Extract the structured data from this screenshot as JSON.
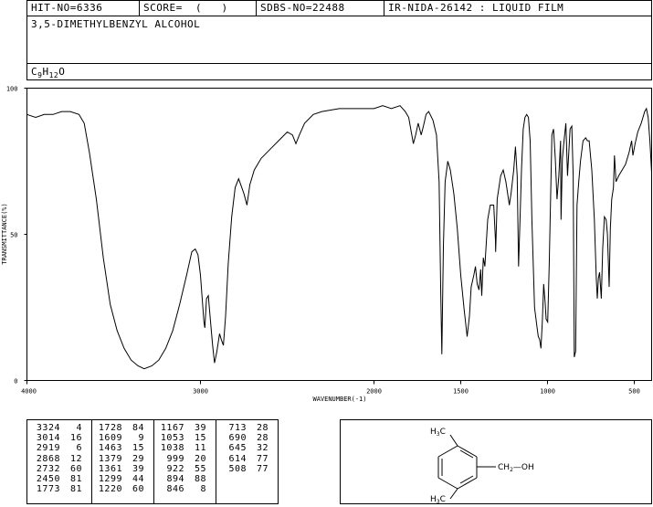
{
  "header": {
    "hit": "HIT-NO=6336",
    "score": "SCORE=  (   )",
    "sdbs": "SDBS-NO=22488",
    "ir": "IR-NIDA-26142 : LIQUID FILM"
  },
  "compound": {
    "name": "3,5-DIMETHYLBENZYL ALCOHOL",
    "formula_parts": [
      "C",
      "9",
      "H",
      "12",
      "O"
    ]
  },
  "chart_data": {
    "type": "line",
    "ylabel": "TRANSMITTANCE(%)",
    "xlabel": "WAVENUMBER(-1)",
    "xlim": [
      4000,
      400
    ],
    "ylim": [
      0,
      100
    ],
    "x_ticks": [
      "4000",
      "3000",
      "2000",
      "1500",
      "1000",
      "500"
    ],
    "y_ticks": [
      "100",
      "50",
      "0"
    ],
    "series": [
      {
        "points": [
          [
            4000,
            91
          ],
          [
            3950,
            90
          ],
          [
            3900,
            91
          ],
          [
            3850,
            91
          ],
          [
            3800,
            92
          ],
          [
            3750,
            92
          ],
          [
            3700,
            91
          ],
          [
            3670,
            88
          ],
          [
            3640,
            78
          ],
          [
            3600,
            62
          ],
          [
            3560,
            42
          ],
          [
            3520,
            26
          ],
          [
            3480,
            17
          ],
          [
            3440,
            11
          ],
          [
            3400,
            7
          ],
          [
            3360,
            5
          ],
          [
            3324,
            4
          ],
          [
            3280,
            5
          ],
          [
            3240,
            7
          ],
          [
            3200,
            11
          ],
          [
            3160,
            17
          ],
          [
            3120,
            26
          ],
          [
            3080,
            36
          ],
          [
            3050,
            44
          ],
          [
            3030,
            45
          ],
          [
            3014,
            43
          ],
          [
            3000,
            36
          ],
          [
            2990,
            28
          ],
          [
            2980,
            20
          ],
          [
            2975,
            18
          ],
          [
            2965,
            28
          ],
          [
            2955,
            29
          ],
          [
            2945,
            22
          ],
          [
            2930,
            12
          ],
          [
            2919,
            6
          ],
          [
            2905,
            10
          ],
          [
            2890,
            16
          ],
          [
            2880,
            14
          ],
          [
            2868,
            12
          ],
          [
            2855,
            22
          ],
          [
            2840,
            40
          ],
          [
            2820,
            56
          ],
          [
            2800,
            66
          ],
          [
            2780,
            69
          ],
          [
            2750,
            64
          ],
          [
            2732,
            60
          ],
          [
            2715,
            67
          ],
          [
            2690,
            72
          ],
          [
            2650,
            76
          ],
          [
            2600,
            79
          ],
          [
            2550,
            82
          ],
          [
            2500,
            85
          ],
          [
            2470,
            84
          ],
          [
            2450,
            81
          ],
          [
            2430,
            84
          ],
          [
            2400,
            88
          ],
          [
            2350,
            91
          ],
          [
            2300,
            92
          ],
          [
            2200,
            93
          ],
          [
            2100,
            93
          ],
          [
            2000,
            93
          ],
          [
            1950,
            94
          ],
          [
            1900,
            93
          ],
          [
            1850,
            94
          ],
          [
            1820,
            92
          ],
          [
            1800,
            90
          ],
          [
            1773,
            81
          ],
          [
            1760,
            84
          ],
          [
            1745,
            88
          ],
          [
            1728,
            84
          ],
          [
            1715,
            87
          ],
          [
            1700,
            91
          ],
          [
            1685,
            92
          ],
          [
            1660,
            89
          ],
          [
            1640,
            84
          ],
          [
            1625,
            68
          ],
          [
            1615,
            30
          ],
          [
            1609,
            9
          ],
          [
            1600,
            46
          ],
          [
            1590,
            68
          ],
          [
            1575,
            75
          ],
          [
            1560,
            72
          ],
          [
            1540,
            64
          ],
          [
            1520,
            52
          ],
          [
            1500,
            36
          ],
          [
            1480,
            24
          ],
          [
            1463,
            15
          ],
          [
            1450,
            22
          ],
          [
            1440,
            32
          ],
          [
            1425,
            36
          ],
          [
            1415,
            39
          ],
          [
            1405,
            33
          ],
          [
            1395,
            31
          ],
          [
            1385,
            38
          ],
          [
            1379,
            29
          ],
          [
            1370,
            42
          ],
          [
            1361,
            39
          ],
          [
            1345,
            55
          ],
          [
            1330,
            60
          ],
          [
            1310,
            60
          ],
          [
            1300,
            48
          ],
          [
            1299,
            44
          ],
          [
            1290,
            62
          ],
          [
            1270,
            70
          ],
          [
            1255,
            72
          ],
          [
            1240,
            68
          ],
          [
            1230,
            64
          ],
          [
            1220,
            60
          ],
          [
            1210,
            64
          ],
          [
            1195,
            72
          ],
          [
            1185,
            80
          ],
          [
            1175,
            70
          ],
          [
            1167,
            39
          ],
          [
            1160,
            52
          ],
          [
            1150,
            72
          ],
          [
            1140,
            86
          ],
          [
            1130,
            90
          ],
          [
            1120,
            91
          ],
          [
            1110,
            90
          ],
          [
            1100,
            82
          ],
          [
            1090,
            55
          ],
          [
            1075,
            25
          ],
          [
            1060,
            18
          ],
          [
            1053,
            15
          ],
          [
            1045,
            14
          ],
          [
            1038,
            11
          ],
          [
            1030,
            20
          ],
          [
            1022,
            33
          ],
          [
            1014,
            27
          ],
          [
            1008,
            21
          ],
          [
            999,
            20
          ],
          [
            990,
            40
          ],
          [
            975,
            84
          ],
          [
            965,
            86
          ],
          [
            955,
            76
          ],
          [
            945,
            62
          ],
          [
            935,
            70
          ],
          [
            925,
            82
          ],
          [
            922,
            55
          ],
          [
            914,
            76
          ],
          [
            905,
            82
          ],
          [
            894,
            88
          ],
          [
            885,
            70
          ],
          [
            870,
            86
          ],
          [
            860,
            87
          ],
          [
            852,
            70
          ],
          [
            846,
            8
          ],
          [
            838,
            10
          ],
          [
            830,
            60
          ],
          [
            820,
            68
          ],
          [
            810,
            75
          ],
          [
            795,
            82
          ],
          [
            780,
            83
          ],
          [
            770,
            82
          ],
          [
            760,
            82
          ],
          [
            745,
            72
          ],
          [
            730,
            55
          ],
          [
            719,
            35
          ],
          [
            713,
            28
          ],
          [
            707,
            35
          ],
          [
            700,
            37
          ],
          [
            690,
            28
          ],
          [
            682,
            45
          ],
          [
            672,
            56
          ],
          [
            662,
            55
          ],
          [
            655,
            50
          ],
          [
            645,
            32
          ],
          [
            638,
            52
          ],
          [
            630,
            62
          ],
          [
            620,
            66
          ],
          [
            614,
            77
          ],
          [
            605,
            68
          ],
          [
            590,
            70
          ],
          [
            570,
            72
          ],
          [
            550,
            74
          ],
          [
            530,
            78
          ],
          [
            515,
            82
          ],
          [
            508,
            77
          ],
          [
            495,
            81
          ],
          [
            480,
            85
          ],
          [
            460,
            88
          ],
          [
            440,
            92
          ],
          [
            430,
            93
          ],
          [
            420,
            90
          ],
          [
            410,
            82
          ],
          [
            400,
            71
          ]
        ]
      }
    ]
  },
  "peak_table": [
    [
      [
        "3324",
        "4"
      ],
      [
        "3014",
        "16"
      ],
      [
        "2919",
        "6"
      ],
      [
        "2868",
        "12"
      ],
      [
        "2732",
        "60"
      ],
      [
        "2450",
        "81"
      ],
      [
        "1773",
        "81"
      ]
    ],
    [
      [
        "1728",
        "84"
      ],
      [
        "1609",
        "9"
      ],
      [
        "1463",
        "15"
      ],
      [
        "1379",
        "29"
      ],
      [
        "1361",
        "39"
      ],
      [
        "1299",
        "44"
      ],
      [
        "1220",
        "60"
      ]
    ],
    [
      [
        "1167",
        "39"
      ],
      [
        "1053",
        "15"
      ],
      [
        "1038",
        "11"
      ],
      [
        "999",
        "20"
      ],
      [
        "922",
        "55"
      ],
      [
        "894",
        "88"
      ],
      [
        "846",
        "8"
      ]
    ],
    [
      [
        "713",
        "28"
      ],
      [
        "690",
        "28"
      ],
      [
        "645",
        "32"
      ],
      [
        "614",
        "77"
      ],
      [
        "508",
        "77"
      ]
    ]
  ],
  "structure": {
    "top_group": [
      "H",
      "3",
      "C"
    ],
    "bottom_group": [
      "H",
      "3",
      "C"
    ],
    "side_chain": "CH",
    "side_chain_sub": "2",
    "side_chain_tail": "—OH"
  }
}
